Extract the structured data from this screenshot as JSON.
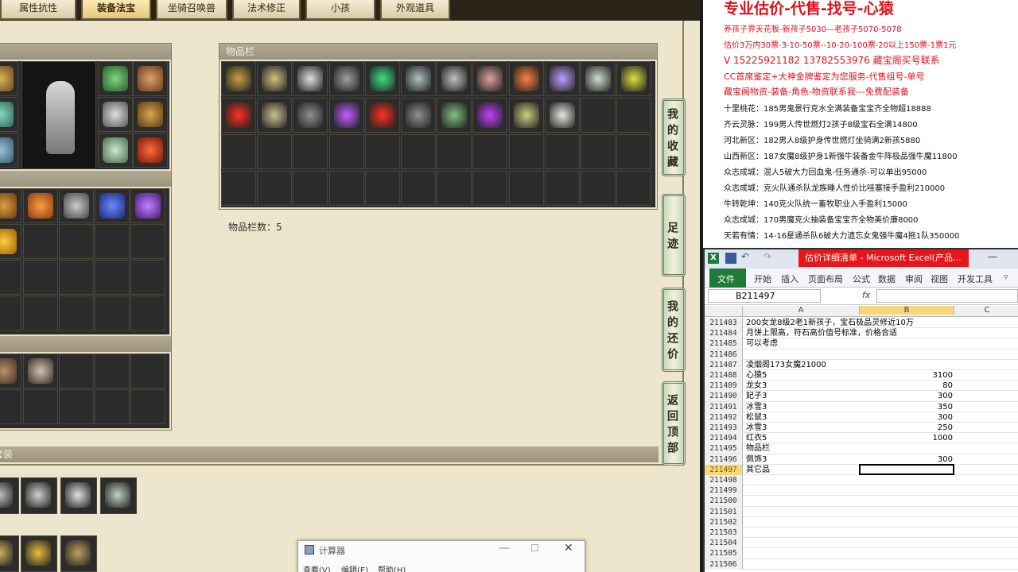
{
  "game": {
    "tabs": [
      "属性抗性",
      "装备法宝",
      "坐骑召唤兽",
      "法术修正",
      "小孩",
      "外观道具"
    ],
    "active_tab_index": 1,
    "inventory_panel_title": "物品栏",
    "inventory_count_label": "物品栏数：5",
    "set_section_label": "套装",
    "side_buttons": [
      "我的收藏",
      "足迹",
      "我的还价",
      "返回顶部"
    ]
  },
  "calculator": {
    "title": "计算器",
    "menu": [
      "查看(V)",
      "编辑(E)",
      "帮助(H)"
    ]
  },
  "info_panel": {
    "red_lines": [
      "专业估价-代售-找号-心猿",
      "养孩子界天花板-新孩子5030—老孩子5070-5078",
      "估价3万内30票-3-10-50票--10-20-100票-20以上150票-1票1元",
      "V 15225921182      13782553976    藏宝阁买号联系",
      "CC首席鉴定+大神金牌鉴定为您服务-代售组号-单号",
      "藏宝阁物资-装备-角色-物资联系我---免费配装备"
    ],
    "black_lines": [
      "十里桃花：185男鬼景行克水全满装备宝宝齐全物超18888",
      "齐云灵脉：199男人传世燃灯2孩子8级宝石全满14800",
      "河北新区：182男人8级护身传世燃灯坐骑满2新孩5880",
      "山西新区：187女魔8级护身1新强牛装备金牛阵极品强牛魔11800",
      "众志成城：混人5破大力回血鬼-任务通杀-可以单出95000",
      "众志成城：克火队通杀队龙族睡人性价比哇塞接手盈利210000",
      "牛转乾坤：140克火队统一畜牧职业入手盈利15000",
      "众志成城：170男魔克火抽装备宝宝齐全物美价廉8000",
      "天若有情：14-16星通杀队6破大力遗忘女鬼强牛魔4拖1队350000"
    ]
  },
  "excel": {
    "title": "估价详细清单 - Microsoft Excel(产品...",
    "ribbon_tabs": [
      "文件",
      "开始",
      "插入",
      "页面布局",
      "公式",
      "数据",
      "审阅",
      "视图",
      "开发工具"
    ],
    "name_box": "B211497",
    "fx": "fx",
    "col_headers": [
      "A",
      "B",
      "C"
    ],
    "rows": [
      {
        "n": "211483",
        "a": "200女龙8级2老1新孩子，宝石极品灵修近10万",
        "b": ""
      },
      {
        "n": "211484",
        "a": "月饼上限高，符石高价值号标准，价格合适",
        "b": ""
      },
      {
        "n": "211485",
        "a": "可以考虑",
        "b": ""
      },
      {
        "n": "211486",
        "a": "",
        "b": ""
      },
      {
        "n": "211487",
        "a": "凌烟阁173女魔21000",
        "b": ""
      },
      {
        "n": "211488",
        "a": "心猿5",
        "b": "3100"
      },
      {
        "n": "211489",
        "a": "龙女3",
        "b": "80"
      },
      {
        "n": "211490",
        "a": "妃子3",
        "b": "300"
      },
      {
        "n": "211491",
        "a": "冰雪3",
        "b": "350"
      },
      {
        "n": "211492",
        "a": "松鼠3",
        "b": "300"
      },
      {
        "n": "211493",
        "a": "冰雪3",
        "b": "250"
      },
      {
        "n": "211494",
        "a": "红衣5",
        "b": "1000"
      },
      {
        "n": "211495",
        "a": "物品栏",
        "b": ""
      },
      {
        "n": "211496",
        "a": "佩饰3",
        "b": "300"
      },
      {
        "n": "211497",
        "a": "其它品",
        "b": ""
      },
      {
        "n": "211498",
        "a": "",
        "b": ""
      },
      {
        "n": "211499",
        "a": "",
        "b": ""
      },
      {
        "n": "211500",
        "a": "",
        "b": ""
      },
      {
        "n": "211501",
        "a": "",
        "b": ""
      },
      {
        "n": "211502",
        "a": "",
        "b": ""
      },
      {
        "n": "211503",
        "a": "",
        "b": ""
      },
      {
        "n": "211504",
        "a": "",
        "b": ""
      },
      {
        "n": "211505",
        "a": "",
        "b": ""
      },
      {
        "n": "211506",
        "a": "",
        "b": ""
      }
    ]
  }
}
